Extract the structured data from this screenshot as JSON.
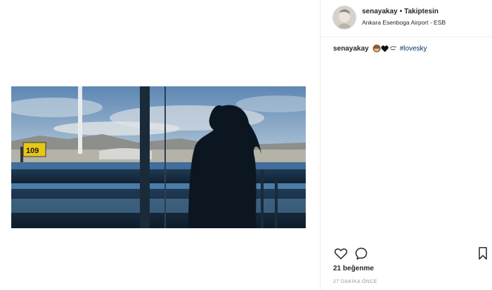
{
  "post": {
    "username": "senayakay",
    "separator": "•",
    "follow_status": "Takiptesin",
    "location": "Ankara Esenboga Airport - ESB",
    "caption": {
      "username": "senayakay",
      "emoji_icons": [
        "monkey-face-icon",
        "black-heart-icon",
        "hand-icon"
      ],
      "hashtag": "#lovesky"
    },
    "likes": "21 beğenme",
    "timestamp": "27 DAKİKA ÖNCE",
    "photo": {
      "description_icons": [
        "gate-sign-icon"
      ],
      "gate_sign": "109"
    }
  },
  "actions": {
    "like_icon": "heart-outline-icon",
    "comment_icon": "comment-bubble-icon",
    "save_icon": "bookmark-icon"
  },
  "colors": {
    "text": "#262626",
    "hashtag": "#003569",
    "muted": "#999999",
    "border": "#efefef",
    "gate_sign": "#e8c619"
  }
}
